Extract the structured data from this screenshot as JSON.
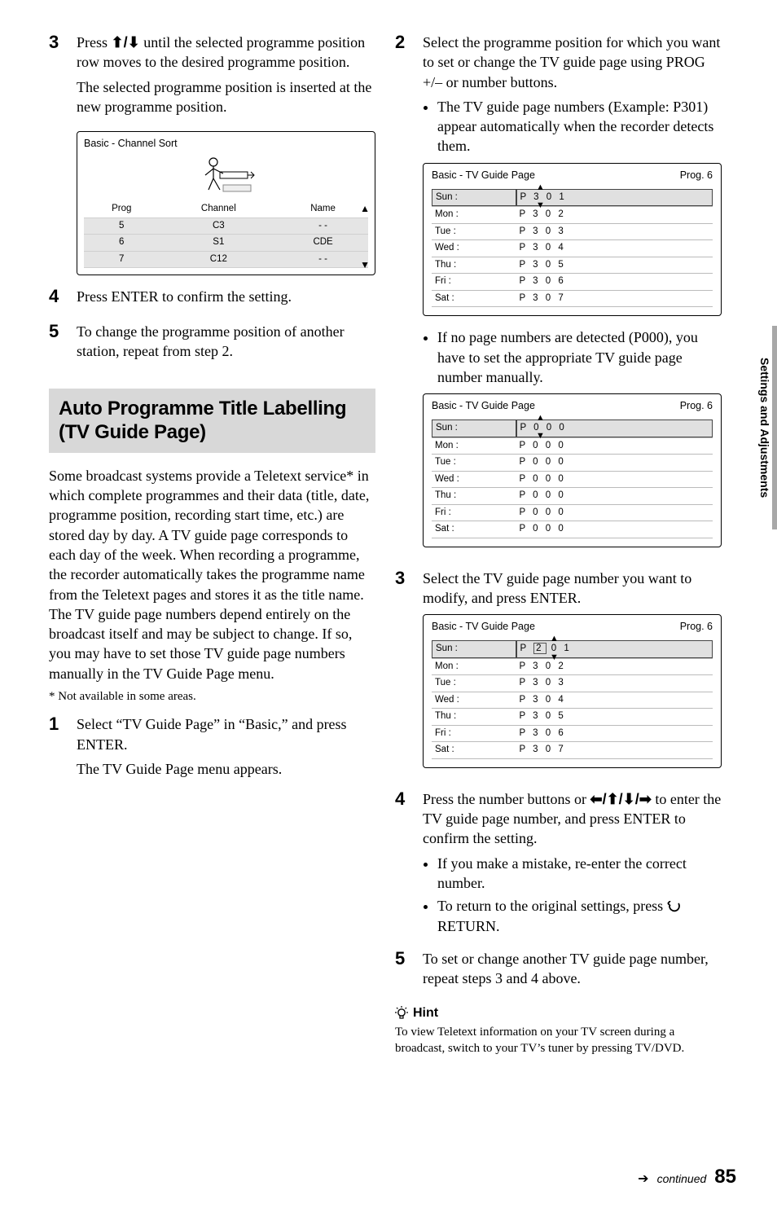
{
  "sidebar_label": "Settings and Adjustments",
  "left": {
    "step3": {
      "num": "3",
      "line1_a": "Press ",
      "line1_b": " until the selected programme position row moves to the desired programme position.",
      "line2": "The selected programme position is inserted at the new programme position."
    },
    "sort_panel": {
      "title": "Basic - Channel Sort",
      "headers": [
        "Prog",
        "Channel",
        "Name"
      ],
      "rows": [
        [
          "5",
          "C3",
          "- -"
        ],
        [
          "6",
          "S1",
          "CDE"
        ],
        [
          "7",
          "C12",
          "- -"
        ]
      ]
    },
    "step4": {
      "num": "4",
      "text": "Press ENTER to confirm the setting."
    },
    "step5": {
      "num": "5",
      "text": "To change the programme position of another station, repeat from step 2."
    },
    "heading": "Auto Programme Title Labelling (TV Guide Page)",
    "body": "Some broadcast systems provide a Teletext service* in which complete programmes and their data (title, date, programme position, recording start time, etc.) are stored day by day. A TV guide page corresponds to each day of the week. When recording a programme, the recorder automatically takes the programme name from the Teletext pages and stores it as the title name. The TV guide page numbers depend entirely on the broadcast itself and may be subject to change. If so, you may have to set those TV guide page numbers manually in the TV Guide Page menu.",
    "footnote": "* Not available in some areas.",
    "step1": {
      "num": "1",
      "line1": "Select “TV Guide Page” in “Basic,” and press ENTER.",
      "line2": "The TV Guide Page menu appears."
    }
  },
  "right": {
    "step2": {
      "num": "2",
      "line1": "Select the programme position for which you want to set or change the TV guide page using PROG +/– or number buttons.",
      "bullet1": "The TV guide page numbers (Example: P301) appear automatically when the recorder detects them."
    },
    "panel1": {
      "title": "Basic - TV Guide Page",
      "prog": "Prog. 6",
      "rows": [
        [
          "Sun :",
          "P 3 0 1"
        ],
        [
          "Mon :",
          "P 3 0 2"
        ],
        [
          "Tue :",
          "P 3 0 3"
        ],
        [
          "Wed :",
          "P 3 0 4"
        ],
        [
          "Thu :",
          "P 3 0 5"
        ],
        [
          "Fri :",
          "P 3 0 6"
        ],
        [
          "Sat :",
          "P 3 0 7"
        ]
      ]
    },
    "bullet2": "If no page numbers are detected (P000), you have to set the appropriate TV guide page number manually.",
    "panel2": {
      "title": "Basic - TV Guide Page",
      "prog": "Prog. 6",
      "rows": [
        [
          "Sun :",
          "P 0 0 0"
        ],
        [
          "Mon :",
          "P 0 0 0"
        ],
        [
          "Tue :",
          "P 0 0 0"
        ],
        [
          "Wed :",
          "P 0 0 0"
        ],
        [
          "Thu :",
          "P 0 0 0"
        ],
        [
          "Fri :",
          "P 0 0 0"
        ],
        [
          "Sat :",
          "P 0 0 0"
        ]
      ]
    },
    "step3": {
      "num": "3",
      "text": "Select the TV guide page number you want to modify, and press ENTER."
    },
    "panel3": {
      "title": "Basic - TV Guide Page",
      "prog": "Prog. 6",
      "rows": [
        [
          "Sun :",
          "P",
          "2",
          "0 1"
        ],
        [
          "Mon :",
          "P 3 0 2"
        ],
        [
          "Tue :",
          "P 3 0 3"
        ],
        [
          "Wed :",
          "P 3 0 4"
        ],
        [
          "Thu :",
          "P 3 0 5"
        ],
        [
          "Fri :",
          "P 3 0 6"
        ],
        [
          "Sat :",
          "P 3 0 7"
        ]
      ]
    },
    "step4": {
      "num": "4",
      "line1_a": "Press the number buttons or ",
      "line1_b": " to enter the TV guide page number, and press ENTER to confirm the setting.",
      "bullet1": "If you make a mistake, re-enter the correct number.",
      "bullet2_a": "To return to the original settings, press ",
      "bullet2_b": " RETURN."
    },
    "step5": {
      "num": "5",
      "text": "To set or change another TV guide page number, repeat steps 3 and 4 above."
    },
    "hint_label": "Hint",
    "hint_text": "To view Teletext information on your TV screen during a broadcast, switch to your TV’s tuner by pressing TV/DVD."
  },
  "footer": {
    "continued": "continued",
    "page": "85"
  },
  "arrows": {
    "up_down": "↑/↓",
    "lr_ud": "←/↑/↓/→"
  }
}
